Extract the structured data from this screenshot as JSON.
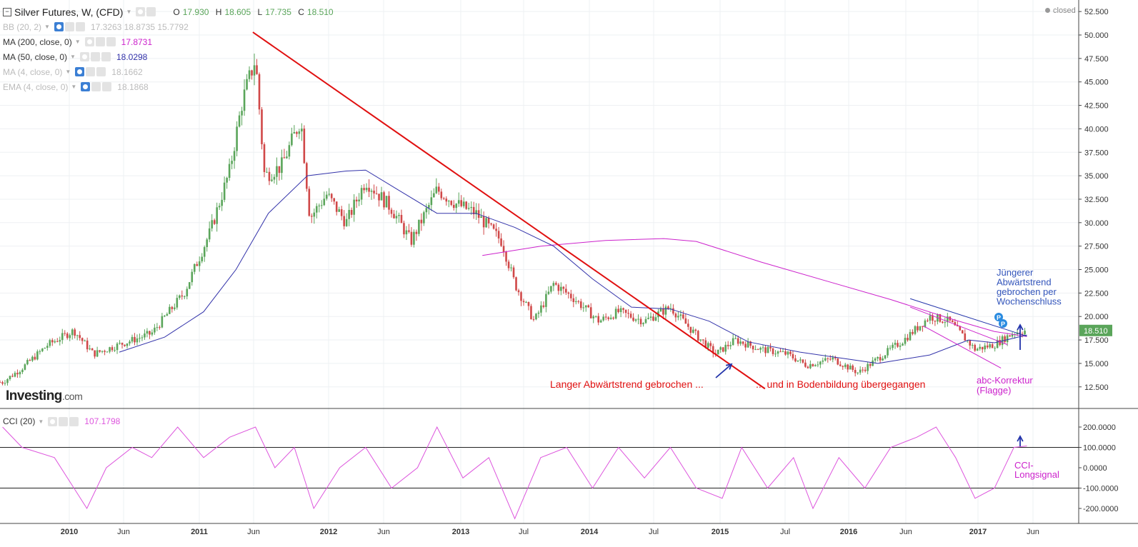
{
  "header": {
    "symbol": "Silver Futures, W, (CFD)",
    "open_label": "O",
    "open": "17.930",
    "high_label": "H",
    "high": "18.605",
    "low_label": "L",
    "low": "17.735",
    "close_label": "C",
    "close": "18.510",
    "status": "closed",
    "logo_main": "Investing",
    "logo_suffix": ".com"
  },
  "indicators": [
    {
      "label": "BB (20, 2)",
      "value": "17.3263 18.8735 15.7792",
      "color": "#bbbbbb",
      "visible": false
    },
    {
      "label": "MA (200, close, 0)",
      "value": "17.8731",
      "color": "#cc22cc",
      "visible": true
    },
    {
      "label": "MA (50, close, 0)",
      "value": "18.0298",
      "color": "#3333aa",
      "visible": true
    },
    {
      "label": "MA (4, close, 0)",
      "value": "18.1662",
      "color": "#bbbbbb",
      "visible": false
    },
    {
      "label": "EMA (4, close, 0)",
      "value": "18.1868",
      "color": "#bbbbbb",
      "visible": false
    }
  ],
  "cci": {
    "label": "CCI (20)",
    "value": "107.1798",
    "color": "#dd55dd"
  },
  "colors": {
    "up": "#5aa55a",
    "down": "#d04848",
    "red_trend": "#e01010",
    "ma200": "#cc22cc",
    "ma50": "#3333aa",
    "cci": "#dd55dd",
    "annot_blue": "#2233aa",
    "annot_pink": "#cc22cc",
    "annot_red": "#e01010"
  },
  "chart_data": {
    "type": "candlestick",
    "x_ticks": [
      "2010",
      "Jun",
      "2011",
      "Jun",
      "2012",
      "Jun",
      "2013",
      "Jul",
      "2014",
      "Jul",
      "2015",
      "Jul",
      "2016",
      "Jun",
      "2017",
      "Jun"
    ],
    "y_ticks": [
      "52.500",
      "50.000",
      "47.500",
      "45.000",
      "42.500",
      "40.000",
      "37.500",
      "35.000",
      "32.500",
      "30.000",
      "27.500",
      "25.000",
      "22.500",
      "20.000",
      "17.500",
      "15.000",
      "12.500"
    ],
    "ylim": [
      11.5,
      53.5
    ],
    "last_price": "18.510",
    "close_series": [
      {
        "x": 2009.35,
        "y": 13.0
      },
      {
        "x": 2009.5,
        "y": 14.5
      },
      {
        "x": 2009.7,
        "y": 17.0
      },
      {
        "x": 2009.9,
        "y": 18.5
      },
      {
        "x": 2010.05,
        "y": 16.0
      },
      {
        "x": 2010.25,
        "y": 17.0
      },
      {
        "x": 2010.5,
        "y": 18.2
      },
      {
        "x": 2010.75,
        "y": 22.5
      },
      {
        "x": 2010.95,
        "y": 29.0
      },
      {
        "x": 2011.1,
        "y": 35.5
      },
      {
        "x": 2011.2,
        "y": 43.0
      },
      {
        "x": 2011.3,
        "y": 47.5
      },
      {
        "x": 2011.37,
        "y": 35.0
      },
      {
        "x": 2011.5,
        "y": 36.0
      },
      {
        "x": 2011.65,
        "y": 41.0
      },
      {
        "x": 2011.72,
        "y": 30.5
      },
      {
        "x": 2011.85,
        "y": 33.0
      },
      {
        "x": 2012.0,
        "y": 30.0
      },
      {
        "x": 2012.15,
        "y": 34.5
      },
      {
        "x": 2012.35,
        "y": 31.5
      },
      {
        "x": 2012.5,
        "y": 28.0
      },
      {
        "x": 2012.7,
        "y": 33.5
      },
      {
        "x": 2012.85,
        "y": 32.0
      },
      {
        "x": 2013.0,
        "y": 31.0
      },
      {
        "x": 2013.2,
        "y": 28.0
      },
      {
        "x": 2013.3,
        "y": 23.5
      },
      {
        "x": 2013.45,
        "y": 19.5
      },
      {
        "x": 2013.6,
        "y": 23.5
      },
      {
        "x": 2013.75,
        "y": 22.0
      },
      {
        "x": 2013.95,
        "y": 19.5
      },
      {
        "x": 2014.1,
        "y": 20.5
      },
      {
        "x": 2014.3,
        "y": 19.5
      },
      {
        "x": 2014.5,
        "y": 21.0
      },
      {
        "x": 2014.7,
        "y": 18.0
      },
      {
        "x": 2014.85,
        "y": 16.0
      },
      {
        "x": 2015.0,
        "y": 17.5
      },
      {
        "x": 2015.2,
        "y": 16.5
      },
      {
        "x": 2015.4,
        "y": 16.0
      },
      {
        "x": 2015.55,
        "y": 14.8
      },
      {
        "x": 2015.75,
        "y": 15.5
      },
      {
        "x": 2015.95,
        "y": 14.0
      },
      {
        "x": 2016.1,
        "y": 15.5
      },
      {
        "x": 2016.3,
        "y": 17.5
      },
      {
        "x": 2016.5,
        "y": 20.0
      },
      {
        "x": 2016.65,
        "y": 19.5
      },
      {
        "x": 2016.85,
        "y": 16.5
      },
      {
        "x": 2017.0,
        "y": 17.0
      },
      {
        "x": 2017.15,
        "y": 18.3
      },
      {
        "x": 2017.25,
        "y": 18.51
      }
    ],
    "ma200": [
      {
        "x": 2013.05,
        "y": 26.5
      },
      {
        "x": 2013.5,
        "y": 27.5
      },
      {
        "x": 2014.0,
        "y": 28.1
      },
      {
        "x": 2014.45,
        "y": 28.3
      },
      {
        "x": 2014.7,
        "y": 28.0
      },
      {
        "x": 2015.2,
        "y": 25.8
      },
      {
        "x": 2015.7,
        "y": 23.8
      },
      {
        "x": 2016.2,
        "y": 21.8
      },
      {
        "x": 2016.7,
        "y": 19.6
      },
      {
        "x": 2017.0,
        "y": 18.4
      },
      {
        "x": 2017.25,
        "y": 17.87
      }
    ],
    "ma50": [
      {
        "x": 2010.25,
        "y": 16.2
      },
      {
        "x": 2010.6,
        "y": 17.8
      },
      {
        "x": 2010.9,
        "y": 20.5
      },
      {
        "x": 2011.15,
        "y": 25.0
      },
      {
        "x": 2011.4,
        "y": 31.0
      },
      {
        "x": 2011.7,
        "y": 35.0
      },
      {
        "x": 2012.0,
        "y": 35.5
      },
      {
        "x": 2012.15,
        "y": 35.6
      },
      {
        "x": 2012.4,
        "y": 33.5
      },
      {
        "x": 2012.7,
        "y": 31.0
      },
      {
        "x": 2013.0,
        "y": 31.0
      },
      {
        "x": 2013.3,
        "y": 29.5
      },
      {
        "x": 2013.6,
        "y": 27.5
      },
      {
        "x": 2013.9,
        "y": 24.0
      },
      {
        "x": 2014.2,
        "y": 21.0
      },
      {
        "x": 2014.5,
        "y": 20.8
      },
      {
        "x": 2014.8,
        "y": 19.5
      },
      {
        "x": 2015.1,
        "y": 17.3
      },
      {
        "x": 2015.5,
        "y": 16.2
      },
      {
        "x": 2015.8,
        "y": 15.6
      },
      {
        "x": 2016.1,
        "y": 15.0
      },
      {
        "x": 2016.5,
        "y": 15.9
      },
      {
        "x": 2016.8,
        "y": 17.5
      },
      {
        "x": 2017.0,
        "y": 17.2
      },
      {
        "x": 2017.25,
        "y": 18.03
      }
    ],
    "trendlines": [
      {
        "name": "long-downtrend",
        "from": {
          "x": 2011.28,
          "y": 50.3
        },
        "to": {
          "x": 2015.23,
          "y": 12.3
        }
      },
      {
        "name": "younger-downtrend",
        "from": {
          "x": 2016.35,
          "y": 21.9
        },
        "to": {
          "x": 2017.25,
          "y": 17.9
        }
      },
      {
        "name": "flag-upper",
        "from": {
          "x": 2016.35,
          "y": 21.0
        },
        "to": {
          "x": 2017.1,
          "y": 17.0
        }
      },
      {
        "name": "flag-lower",
        "from": {
          "x": 2016.45,
          "y": 19.0
        },
        "to": {
          "x": 2017.05,
          "y": 14.5
        }
      }
    ],
    "cci": {
      "y_ticks": [
        "200.0000",
        "100.0000",
        "0.0000",
        "-100.0000",
        "-200.0000"
      ],
      "ylim": [
        -300,
        300
      ],
      "levels": [
        100,
        -100
      ],
      "series": [
        {
          "x": 2009.35,
          "y": 200
        },
        {
          "x": 2009.5,
          "y": 100
        },
        {
          "x": 2009.75,
          "y": 50
        },
        {
          "x": 2009.9,
          "y": -100
        },
        {
          "x": 2010.0,
          "y": -200
        },
        {
          "x": 2010.15,
          "y": 0
        },
        {
          "x": 2010.35,
          "y": 100
        },
        {
          "x": 2010.5,
          "y": 50
        },
        {
          "x": 2010.7,
          "y": 200
        },
        {
          "x": 2010.9,
          "y": 50
        },
        {
          "x": 2011.1,
          "y": 150
        },
        {
          "x": 2011.3,
          "y": 200
        },
        {
          "x": 2011.45,
          "y": 0
        },
        {
          "x": 2011.6,
          "y": 100
        },
        {
          "x": 2011.75,
          "y": -200
        },
        {
          "x": 2011.95,
          "y": 0
        },
        {
          "x": 2012.15,
          "y": 100
        },
        {
          "x": 2012.35,
          "y": -100
        },
        {
          "x": 2012.55,
          "y": 0
        },
        {
          "x": 2012.7,
          "y": 200
        },
        {
          "x": 2012.9,
          "y": -50
        },
        {
          "x": 2013.1,
          "y": 50
        },
        {
          "x": 2013.3,
          "y": -250
        },
        {
          "x": 2013.5,
          "y": 50
        },
        {
          "x": 2013.7,
          "y": 100
        },
        {
          "x": 2013.9,
          "y": -100
        },
        {
          "x": 2014.1,
          "y": 100
        },
        {
          "x": 2014.3,
          "y": -50
        },
        {
          "x": 2014.5,
          "y": 100
        },
        {
          "x": 2014.7,
          "y": -100
        },
        {
          "x": 2014.9,
          "y": -150
        },
        {
          "x": 2015.05,
          "y": 100
        },
        {
          "x": 2015.25,
          "y": -100
        },
        {
          "x": 2015.45,
          "y": 50
        },
        {
          "x": 2015.6,
          "y": -200
        },
        {
          "x": 2015.8,
          "y": 50
        },
        {
          "x": 2016.0,
          "y": -100
        },
        {
          "x": 2016.2,
          "y": 100
        },
        {
          "x": 2016.4,
          "y": 150
        },
        {
          "x": 2016.55,
          "y": 200
        },
        {
          "x": 2016.7,
          "y": 50
        },
        {
          "x": 2016.85,
          "y": -150
        },
        {
          "x": 2017.0,
          "y": -100
        },
        {
          "x": 2017.15,
          "y": 100
        },
        {
          "x": 2017.25,
          "y": 107.18
        }
      ]
    }
  },
  "annotations": {
    "long_trend": "Langer Abwärtstrend gebrochen ...",
    "bottom_formation": "... und in Bodenbildung übergegangen",
    "young_trend_l1": "Jüngerer",
    "young_trend_l2": "Abwärtstrend",
    "young_trend_l3": "gebrochen per",
    "young_trend_l4": "Wochenschluss",
    "abc_l1": "abc-Korrektur",
    "abc_l2": "(Flagge)",
    "cci_l1": "CCI-",
    "cci_l2": "Longsignal",
    "marker_p": "P"
  }
}
